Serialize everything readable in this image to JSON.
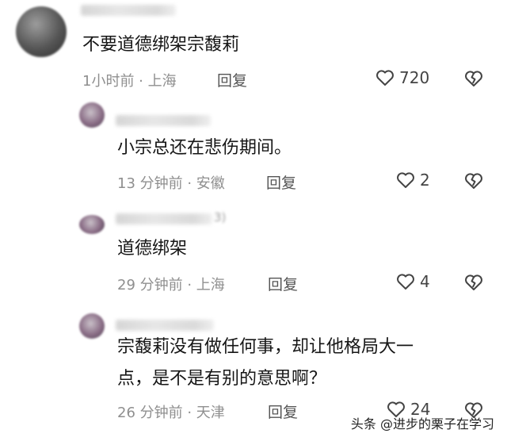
{
  "comments": [
    {
      "text": "不要道德绑架宗馥莉",
      "meta": "1小时前 · 上海",
      "reply": "回复",
      "likes": "720"
    },
    {
      "text": "小宗总还在悲伤期间。",
      "meta": "13 分钟前 · 安徽",
      "reply": "回复",
      "likes": "2"
    },
    {
      "name_visible": "3)",
      "text": "道德绑架",
      "meta": "29 分钟前 · 上海",
      "reply": "回复",
      "likes": "4"
    },
    {
      "text_line1": "宗馥莉没有做任何事，却让他格局大一",
      "text_line2": "点，是不是有别的意思啊？",
      "meta": "26 分钟前 · 天津",
      "reply": "回复",
      "likes": "24"
    }
  ],
  "watermark": "头条 @进步的栗子在学习",
  "icons": {
    "like": "heart-outline-icon",
    "dislike": "broken-heart-icon"
  },
  "colors": {
    "text": "#161616",
    "meta": "#8f8f8f",
    "icon": "#444444"
  }
}
